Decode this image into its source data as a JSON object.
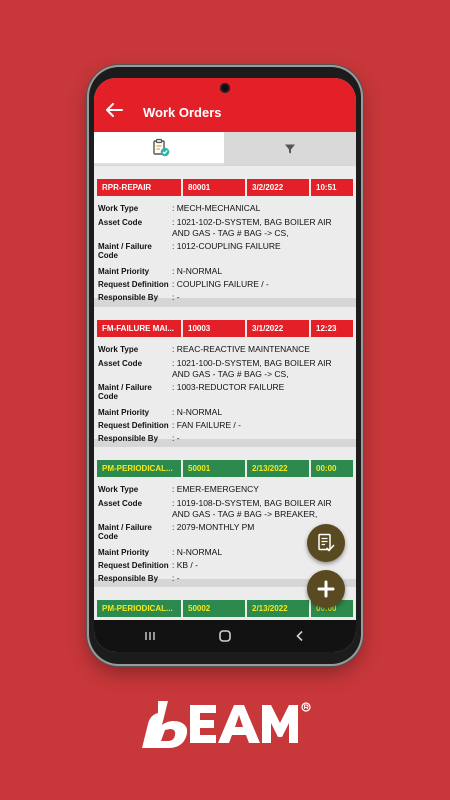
{
  "app": {
    "title": "Work Orders"
  },
  "labels": {
    "work_type": "Work Type",
    "asset_code": "Asset Code",
    "maint_failure_code": "Maint / Failure Code",
    "maint_priority": "Maint Priority",
    "request_definition": "Request Definition",
    "responsible_by": "Responsible By"
  },
  "work_orders": [
    {
      "type": "RPR-REPAIR",
      "number": "80001",
      "date": "3/2/2022",
      "time": "10:51",
      "header_color": "#e32028",
      "work_type": ": MECH-MECHANICAL",
      "asset_code": ": 1021-102-D-SYSTEM, BAG BOILER AIR AND GAS - TAG # BAG -> CS,",
      "failure_code": ": 1012-COUPLING FAILURE",
      "priority": ": N-NORMAL",
      "request_definition": ": COUPLING FAILURE /   -",
      "responsible_by": ": -"
    },
    {
      "type": "FM-FAILURE MAI...",
      "number": "10003",
      "date": "3/1/2022",
      "time": "12:23",
      "header_color": "#e32028",
      "work_type": ": REAC-REACTIVE MAINTENANCE",
      "asset_code": ": 1021-100-D-SYSTEM, BAG BOILER AIR AND GAS - TAG # BAG -> CS,",
      "failure_code": ": 1003-REDUCTOR FAILURE",
      "priority": ": N-NORMAL",
      "request_definition": ": FAN FAILURE /   -",
      "responsible_by": ": -"
    },
    {
      "type": "PM-PERIODICAL...",
      "number": "50001",
      "date": "2/13/2022",
      "time": "00:00",
      "header_color": "#2d8a4e",
      "work_type": ": EMER-EMERGENCY",
      "asset_code": ": 1019-108-D-SYSTEM, BAG BOILER AIR AND GAS - TAG # BAG -> BREAKER,",
      "failure_code": ": 2079-MONTHLY PM",
      "priority": ": N-NORMAL",
      "request_definition": ": KB /   -",
      "responsible_by": ": -"
    },
    {
      "type": "PM-PERIODICAL...",
      "number": "50002",
      "date": "2/13/2022",
      "time": "00:00",
      "header_color": "#2d8a4e"
    }
  ],
  "icons": {
    "back": "arrow-left-icon",
    "tab_list": "clipboard-check-icon",
    "tab_filter": "filter-icon",
    "fab_approve": "document-check-icon",
    "fab_add": "plus-icon",
    "nav_recents": "recents-icon",
    "nav_home": "home-icon",
    "nav_back": "back-chevron-icon"
  },
  "colors": {
    "brand_red": "#e32028",
    "background": "#c8373a",
    "pm_green": "#2d8a4e",
    "pm_text": "#f4ea1c",
    "fab": "#5a4a22"
  },
  "brand": {
    "logo_text": "bEAM"
  }
}
